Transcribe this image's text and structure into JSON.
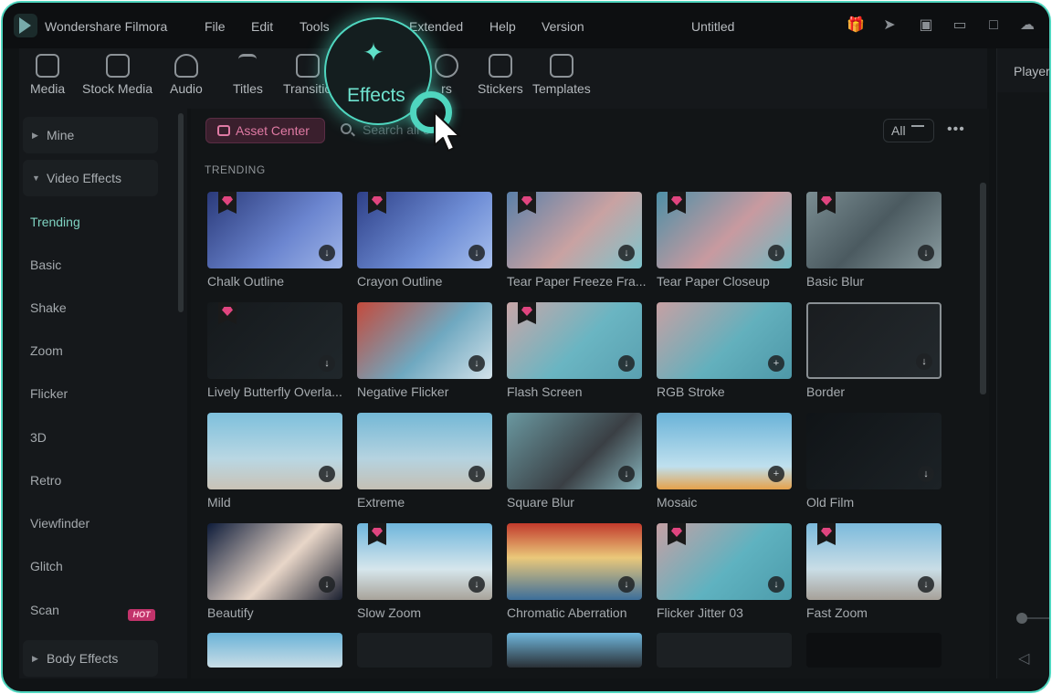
{
  "app": {
    "name": "Wondershare Filmora",
    "doc_title": "Untitled"
  },
  "menu": [
    "File",
    "Edit",
    "Tools",
    "Extended",
    "Help",
    "Version"
  ],
  "title_icons": [
    "gift-icon",
    "send-icon",
    "task-list-icon",
    "layout-icon",
    "save-icon",
    "cloud-upload-icon"
  ],
  "toolbar": [
    {
      "label": "Media",
      "icon": "media-icon"
    },
    {
      "label": "Stock Media",
      "icon": "stock-media-icon"
    },
    {
      "label": "Audio",
      "icon": "audio-icon"
    },
    {
      "label": "Titles",
      "icon": "titles-icon"
    },
    {
      "label": "Transitio",
      "icon": "transitions-icon"
    },
    {
      "label": "Effects",
      "icon": "effects-icon"
    },
    {
      "label": "rs",
      "icon": "filters-icon"
    },
    {
      "label": "Stickers",
      "icon": "stickers-icon"
    },
    {
      "label": "Templates",
      "icon": "templates-icon"
    }
  ],
  "player_label": "Player",
  "sidebar": {
    "groups": [
      "Mine",
      "Video Effects",
      "Body Effects"
    ],
    "items": [
      "Trending",
      "Basic",
      "Shake",
      "Zoom",
      "Flicker",
      "3D",
      "Retro",
      "Viewfinder",
      "Glitch",
      "Scan"
    ],
    "hot_badge": "HOT"
  },
  "asset_center": "Asset Center",
  "search": {
    "placeholder": "Search all e"
  },
  "filter": {
    "label": "All"
  },
  "section": "TRENDING",
  "effects": [
    "Chalk Outline",
    "Crayon Outline",
    "Tear Paper Freeze Fra...",
    "Tear Paper Closeup",
    "Basic Blur",
    "Lively Butterfly Overla...",
    "Negative Flicker",
    "Flash Screen",
    "RGB Stroke",
    "Border",
    "Mild",
    "Extreme",
    "Square Blur",
    "Mosaic",
    "Old Film",
    "Beautify",
    "Slow Zoom",
    "Chromatic Aberration",
    "Flicker Jitter 03",
    "Fast Zoom"
  ],
  "colors": {
    "accent": "#4fd6bf",
    "active_item": "#7fd3c2",
    "premium": "#e0457f",
    "hot": "#c2336b"
  }
}
